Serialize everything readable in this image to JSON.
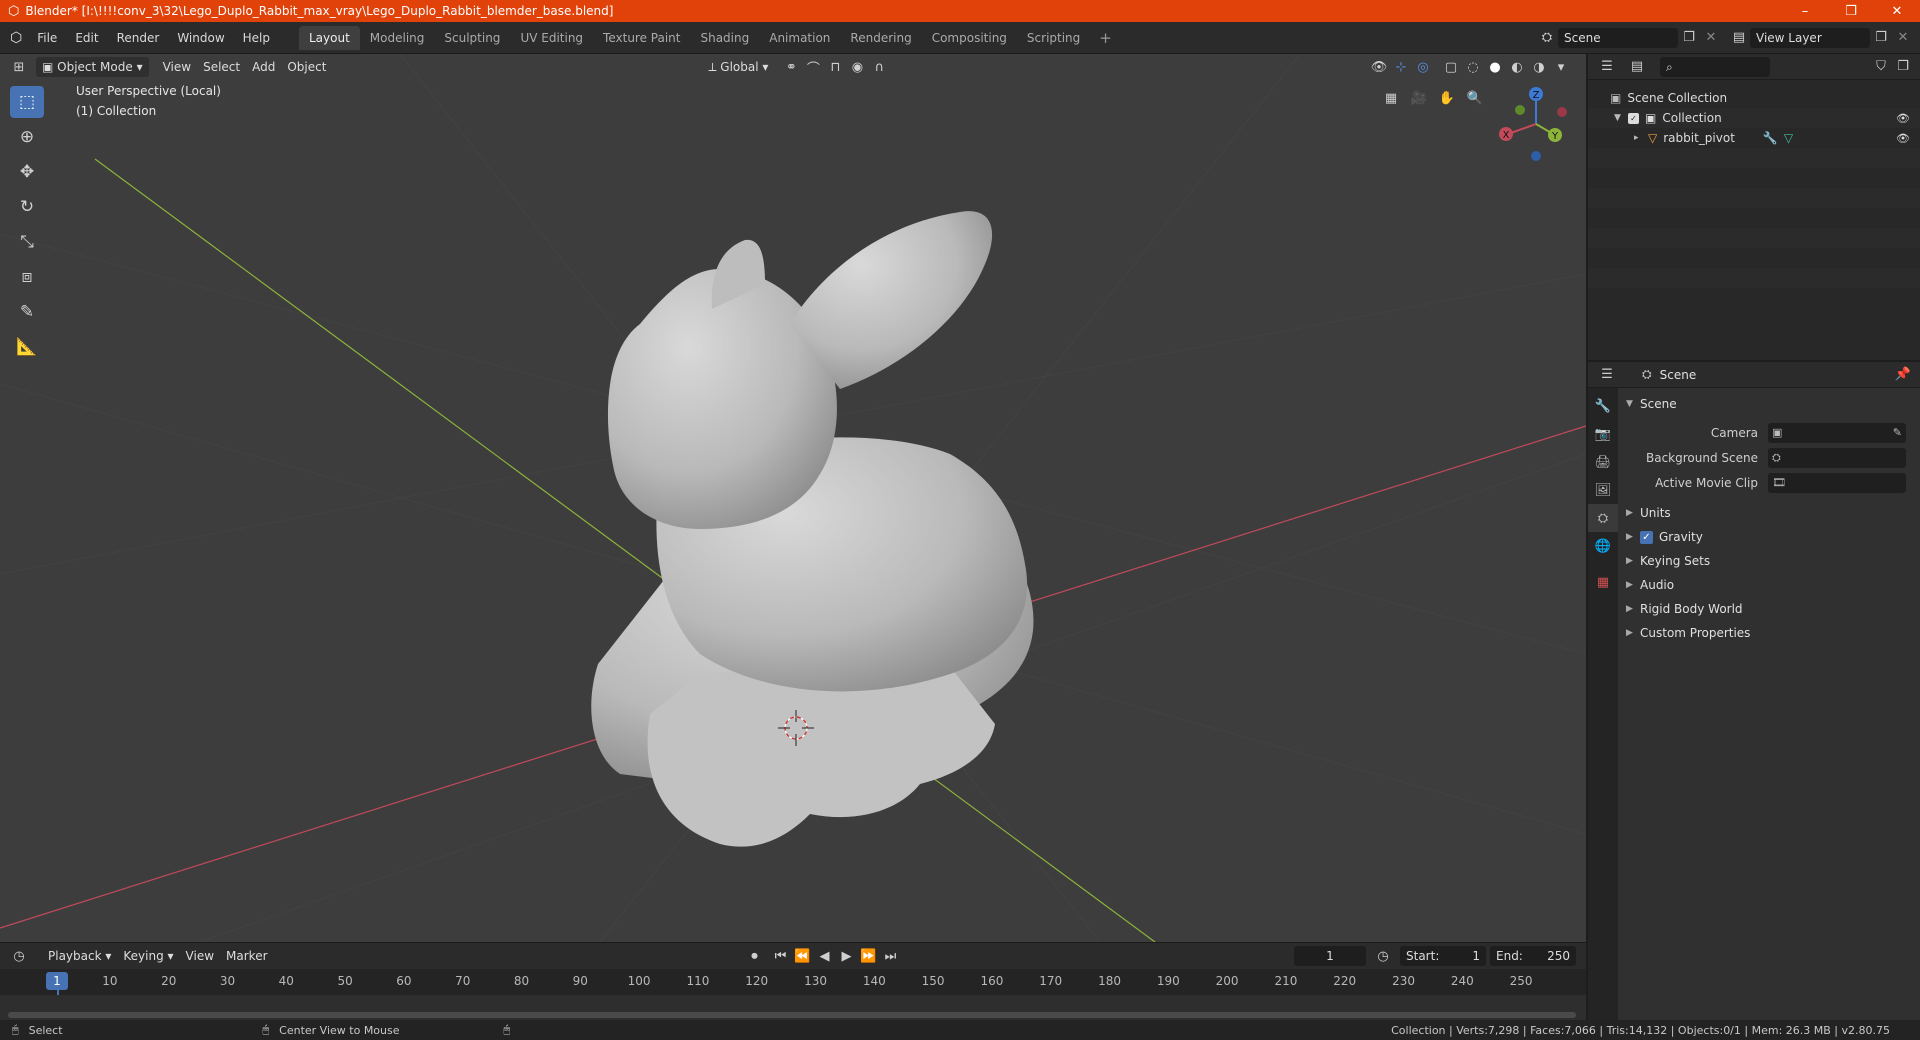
{
  "window": {
    "title": "Blender* [I:\\!!!!conv_3\\32\\Lego_Duplo_Rabbit_max_vray\\Lego_Duplo_Rabbit_blemder_base.blend]",
    "minimize": "–",
    "maximize": "❐",
    "close": "✕"
  },
  "menubar": {
    "items": [
      "File",
      "Edit",
      "Render",
      "Window",
      "Help"
    ],
    "workspaces": [
      "Layout",
      "Modeling",
      "Sculpting",
      "UV Editing",
      "Texture Paint",
      "Shading",
      "Animation",
      "Rendering",
      "Compositing",
      "Scripting"
    ],
    "active_workspace": "Layout",
    "add_workspace": "+",
    "scene": "Scene",
    "view_layer": "View Layer"
  },
  "viewport": {
    "mode": "Object Mode",
    "menus": [
      "View",
      "Select",
      "Add",
      "Object"
    ],
    "transform_orientation": "Global",
    "info_line1": "User Perspective (Local)",
    "info_line2": "(1) Collection",
    "gizmo": {
      "x": "X",
      "y": "Y",
      "z": "Z"
    },
    "colors": {
      "x_axis": "#c24a5a",
      "y_axis": "#8cb43a",
      "z_axis": "#3b7ad6",
      "background": "#3d3d3d",
      "grid": "#474747",
      "model": "#c8c8c8"
    }
  },
  "timeline": {
    "menus": [
      "Playback",
      "Keying",
      "View",
      "Marker"
    ],
    "current_frame": "1",
    "start_label": "Start:",
    "start": "1",
    "end_label": "End:",
    "end": "250",
    "ruler": [
      "1",
      "10",
      "20",
      "30",
      "40",
      "50",
      "60",
      "70",
      "80",
      "90",
      "100",
      "110",
      "120",
      "130",
      "140",
      "150",
      "160",
      "170",
      "180",
      "190",
      "200",
      "210",
      "220",
      "230",
      "240",
      "250"
    ]
  },
  "statusbar": {
    "select": "Select",
    "center_view": "Center View to Mouse",
    "stats": "Collection | Verts:7,298 | Faces:7,066 | Tris:14,132 | Objects:0/1 | Mem: 26.3 MB | v2.80.75"
  },
  "outliner": {
    "scene_collection": "Scene Collection",
    "collection": "Collection",
    "object": "rabbit_pivot"
  },
  "properties": {
    "header": "Scene",
    "scene_panel": "Scene",
    "camera_label": "Camera",
    "background_scene_label": "Background Scene",
    "active_movie_clip_label": "Active Movie Clip",
    "panels": [
      "Units",
      "Gravity",
      "Keying Sets",
      "Audio",
      "Rigid Body World",
      "Custom Properties"
    ]
  }
}
